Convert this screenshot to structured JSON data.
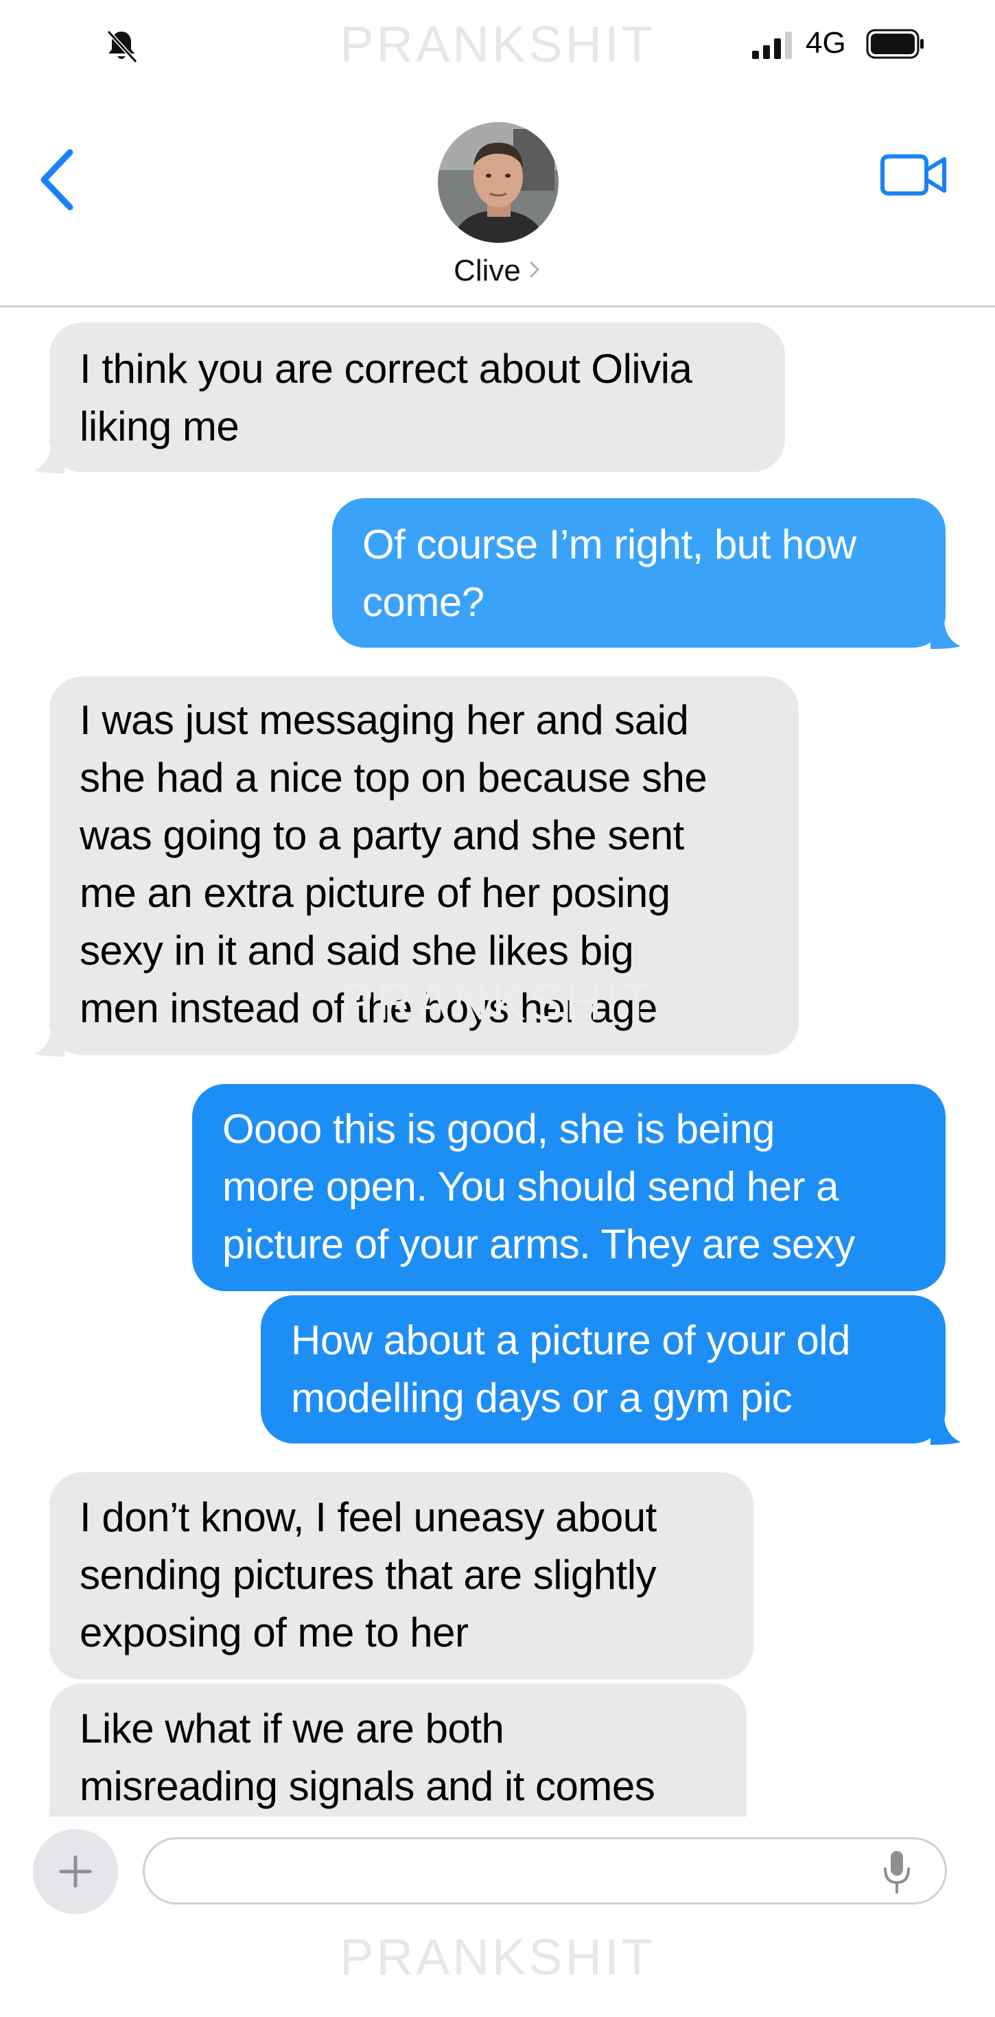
{
  "watermark": "PRANKSHIT",
  "status_bar": {
    "network": "4G"
  },
  "header": {
    "contact_name": "Clive"
  },
  "colors": {
    "accent": "#1a82f7",
    "sent_bubble_light": "#3aa3f9",
    "sent_bubble": "#1d8ef5",
    "received_bubble": "#e9e9eb"
  },
  "messages": [
    {
      "direction": "received",
      "text": "I think you are correct about Olivia\nliking me"
    },
    {
      "direction": "sent",
      "text": "Of course I’m right, but how\ncome?"
    },
    {
      "direction": "received",
      "text": "I was just messaging her and said\nshe had a nice top on because she\nwas going to a party and she sent\nme an extra picture of her posing\nsexy in it and said she likes big\nmen instead of the boys her age"
    },
    {
      "direction": "sent",
      "text": "Oooo this is good, she is being\nmore open. You should send her a\npicture of your arms. They are sexy"
    },
    {
      "direction": "sent",
      "text": "How about a picture of your old\nmodelling days or a gym pic"
    },
    {
      "direction": "received",
      "text": "I don’t know, I feel uneasy about\nsending pictures that are slightly\nexposing of me to her"
    },
    {
      "direction": "received",
      "text": "Like what if we are both\nmisreading signals and it comes"
    }
  ],
  "composer": {
    "placeholder": ""
  },
  "icons": {
    "status_left": "bell-slash-icon",
    "back": "chevron-left-icon",
    "video": "video-camera-icon",
    "add": "plus-icon",
    "dictation": "microphone-icon"
  }
}
